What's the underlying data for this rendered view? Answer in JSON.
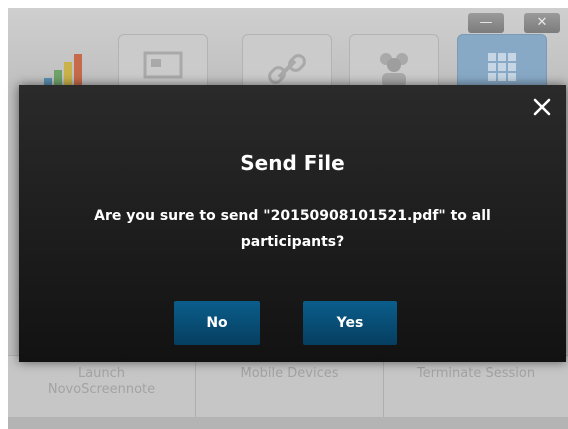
{
  "background_app": {
    "window_controls": {
      "minimize": "—",
      "close": "✕"
    },
    "toolbar_tiles": [
      {
        "icon": "chart-icon"
      },
      {
        "icon": "presentation-icon"
      },
      {
        "icon": "link-icon"
      },
      {
        "icon": "users-icon"
      },
      {
        "icon": "grid-icon",
        "active": true
      }
    ],
    "footer": {
      "launch_label_1": "Launch",
      "launch_label_2": "NovoScreennote",
      "mobile_label": "Mobile Devices",
      "terminate_label": "Terminate Session"
    }
  },
  "dialog": {
    "title": "Send File",
    "message": "Are you sure to send \"20150908101521.pdf\" to all participants?",
    "close_icon": "close-icon",
    "buttons": {
      "no": "No",
      "yes": "Yes"
    },
    "colors": {
      "button": "#0a5e8c",
      "dialog_bg": "#1c1c1c",
      "text": "#ffffff"
    }
  }
}
